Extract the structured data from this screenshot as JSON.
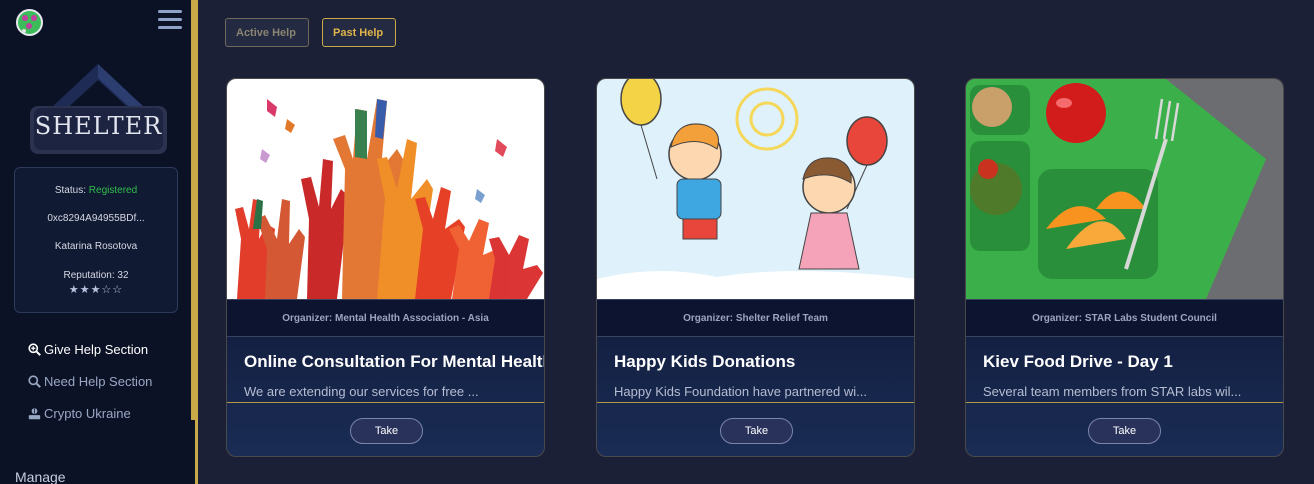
{
  "sidebar": {
    "logo_text": "SHELTER",
    "profile": {
      "status_label": "Status:",
      "status_value": "Registered",
      "wallet": "0xc8294A94955BDf...",
      "name": "Katarina Rosotova",
      "reputation_label": "Reputation: 32",
      "stars": "★★★☆☆"
    },
    "nav": [
      {
        "label": "Give Help Section",
        "icon": "give-help-icon"
      },
      {
        "label": "Need Help Section",
        "icon": "search-icon"
      },
      {
        "label": "Crypto Ukraine",
        "icon": "hand-coin-icon"
      }
    ],
    "manage_label": "Manage"
  },
  "tabs": {
    "active_help": "Active Help",
    "past_help": "Past Help"
  },
  "cards": [
    {
      "organizer": "Organizer: Mental Health Association - Asia",
      "title": "Online Consultation For Mental Health",
      "description": "We are extending our services for free ...",
      "button": "Take"
    },
    {
      "organizer": "Organizer: Shelter Relief Team",
      "title": "Happy Kids Donations",
      "description": "Happy Kids Foundation have partnered wi...",
      "button": "Take"
    },
    {
      "organizer": "Organizer: STAR Labs Student Council",
      "title": "Kiev Food Drive - Day 1",
      "description": "Several team members from STAR labs wil...",
      "button": "Take"
    }
  ],
  "colors": {
    "accent_gold": "#c9a948",
    "status_green": "#2fbf4a",
    "background": "#1b2036"
  }
}
